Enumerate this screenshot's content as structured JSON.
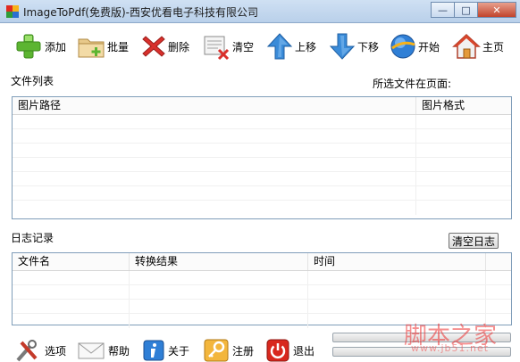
{
  "window": {
    "title": "ImageToPdf(免费版)-西安优看电子科技有限公司",
    "minimize_glyph": "—",
    "maximize_glyph": "□",
    "close_glyph": "✕"
  },
  "toolbar": {
    "add": "添加",
    "batch": "批量",
    "delete": "删除",
    "clear": "清空",
    "move_up": "上移",
    "move_down": "下移",
    "start": "开始",
    "home": "主页"
  },
  "file_list": {
    "label": "文件列表",
    "selected_on_page": "所选文件在页面:",
    "columns": [
      "图片路径",
      "图片格式"
    ]
  },
  "log": {
    "label": "日志记录",
    "clear_button": "清空日志",
    "columns": [
      "文件名",
      "转换结果",
      "时间"
    ]
  },
  "bottom": {
    "options": "选项",
    "help": "帮助",
    "about": "关于",
    "register": "注册",
    "exit": "退出"
  },
  "progress": {
    "bar1": 0,
    "bar2": 0
  },
  "watermark": {
    "text": "脚本之家",
    "url": "www.jb51.net"
  },
  "colors": {
    "accent_blue": "#3a8bd8",
    "delete_red": "#d9302c",
    "add_green": "#5cb531",
    "exit_red": "#d8281e"
  }
}
